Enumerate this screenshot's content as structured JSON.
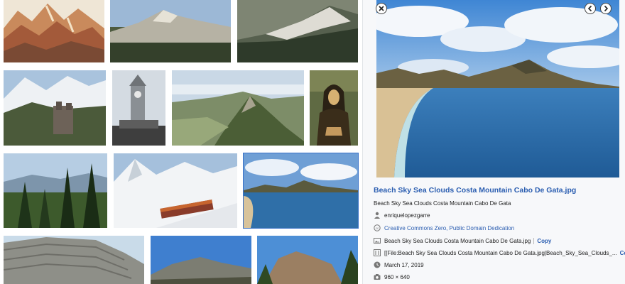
{
  "panel": {
    "close_icon": "close-icon",
    "prev_icon": "chevron-left-icon",
    "next_icon": "chevron-right-icon",
    "title": "Beach Sky Sea Clouds Costa Mountain Cabo De Gata.jpg",
    "description": "Beach Sky Sea Clouds Costa Mountain Cabo De Gata",
    "author": "enriquelopezgarre",
    "license": "Creative Commons Zero, Public Domain Dedication",
    "filename": "Beach Sky Sea Clouds Costa Mountain Cabo De Gata.jpg",
    "wikitext": "[[File:Beach Sky Sea Clouds Costa Mountain Cabo De Gata.jpg|Beach_Sky_Sea_Clouds_...",
    "copy_label": "Copy",
    "date": "March 17, 2019",
    "dimensions": "960 × 640",
    "accent_color": "#2a5db0"
  },
  "grid": {
    "thumbnails": [
      {
        "subject": "mountain-painting",
        "selected": false
      },
      {
        "subject": "mountain-ridge",
        "selected": false
      },
      {
        "subject": "rocky-mountain-slope",
        "selected": false
      },
      {
        "subject": "snowy-mountains-castle",
        "selected": false
      },
      {
        "subject": "clock-tower",
        "selected": false
      },
      {
        "subject": "green-mountain-peak",
        "selected": false
      },
      {
        "subject": "mona-lisa-painting",
        "selected": false
      },
      {
        "subject": "pine-forest",
        "selected": false
      },
      {
        "subject": "snow-train",
        "selected": false
      },
      {
        "subject": "beach-sea-mountain",
        "selected": true
      },
      {
        "subject": "layered-rock-formation",
        "selected": false
      },
      {
        "subject": "mountain-blue-sky",
        "selected": false
      },
      {
        "subject": "rocky-peak-trees",
        "selected": false
      }
    ]
  }
}
